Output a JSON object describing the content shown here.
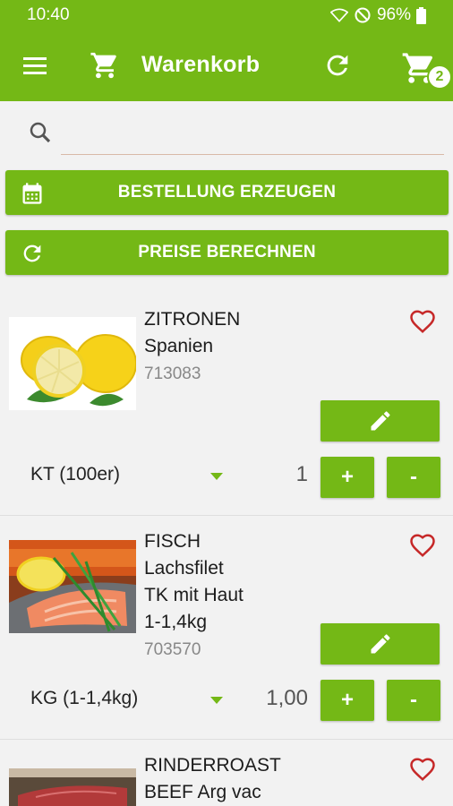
{
  "status": {
    "time": "10:40",
    "battery": "96%"
  },
  "app_bar": {
    "title": "Warenkorb",
    "cart_count": "2"
  },
  "search": {
    "placeholder": ""
  },
  "buttons": {
    "create_order": "BESTELLUNG ERZEUGEN",
    "calc_prices": "PREISE BERECHNEN"
  },
  "items": [
    {
      "name_lines": [
        "ZITRONEN",
        "Spanien"
      ],
      "code": "713083",
      "unit": "KT (100er)",
      "qty": "1",
      "plus": "+",
      "minus": "-"
    },
    {
      "name_lines": [
        "FISCH",
        "Lachsfilet",
        "TK mit Haut",
        "1-1,4kg"
      ],
      "code": "703570",
      "unit": "KG (1-1,4kg)",
      "qty": "1,00",
      "plus": "+",
      "minus": "-"
    },
    {
      "name_lines": [
        "RINDERROAST",
        "BEEF Arg vac"
      ]
    }
  ],
  "colors": {
    "accent": "#74b816",
    "heart": "#c62828"
  }
}
